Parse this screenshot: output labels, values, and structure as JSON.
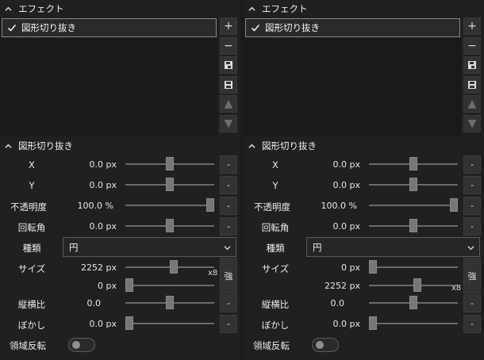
{
  "panes": [
    {
      "effect_header": "エフェクト",
      "effect_item": "図形切り抜き",
      "side_buttons": [
        "+",
        "−",
        "save-as",
        "save",
        "▲",
        "▼"
      ],
      "section_header": "図形切り抜き",
      "params": {
        "x": {
          "label": "X",
          "value": "0.0 px",
          "level": 0.5
        },
        "y": {
          "label": "Y",
          "value": "0.0 px",
          "level": 0.5
        },
        "opacity": {
          "label": "不透明度",
          "value": "100.0 %",
          "level": 1.0
        },
        "rotation": {
          "label": "回転角",
          "value": "0.0 px",
          "level": 0.5
        },
        "type": {
          "label": "種類",
          "value": "円"
        },
        "size": {
          "label": "サイズ",
          "value1": "2252 px",
          "level1": 0.55,
          "value2": "0 px",
          "level2": 0.0,
          "x8": "x8",
          "strong": "強"
        },
        "aspect": {
          "label": "縦横比",
          "value": "0.0",
          "level": 0.5
        },
        "blur": {
          "label": "ぼかし",
          "value": "0.0 px",
          "level": 0.0
        },
        "invert": {
          "label": "領域反転"
        }
      }
    },
    {
      "effect_header": "エフェクト",
      "effect_item": "図形切り抜き",
      "side_buttons": [
        "+",
        "−",
        "save-as",
        "save",
        "▲",
        "▼"
      ],
      "section_header": "図形切り抜き",
      "params": {
        "x": {
          "label": "X",
          "value": "0.0 px",
          "level": 0.5
        },
        "y": {
          "label": "Y",
          "value": "0.0 px",
          "level": 0.5
        },
        "opacity": {
          "label": "不透明度",
          "value": "100.0 %",
          "level": 1.0
        },
        "rotation": {
          "label": "回転角",
          "value": "0.0 px",
          "level": 0.5
        },
        "type": {
          "label": "種類",
          "value": "円"
        },
        "size": {
          "label": "サイズ",
          "value1": "0 px",
          "level1": 0.0,
          "value2": "2252 px",
          "level2": 0.55,
          "x8": "x8",
          "strong": "強"
        },
        "aspect": {
          "label": "縦横比",
          "value": "0.0",
          "level": 0.5
        },
        "blur": {
          "label": "ぼかし",
          "value": "0.0 px",
          "level": 0.0
        },
        "invert": {
          "label": "領域反転"
        }
      }
    }
  ],
  "colors": {
    "bg": "#202020",
    "panel": "#1a1a1a",
    "button": "#323232",
    "accent_border": "#8a8a8a"
  }
}
